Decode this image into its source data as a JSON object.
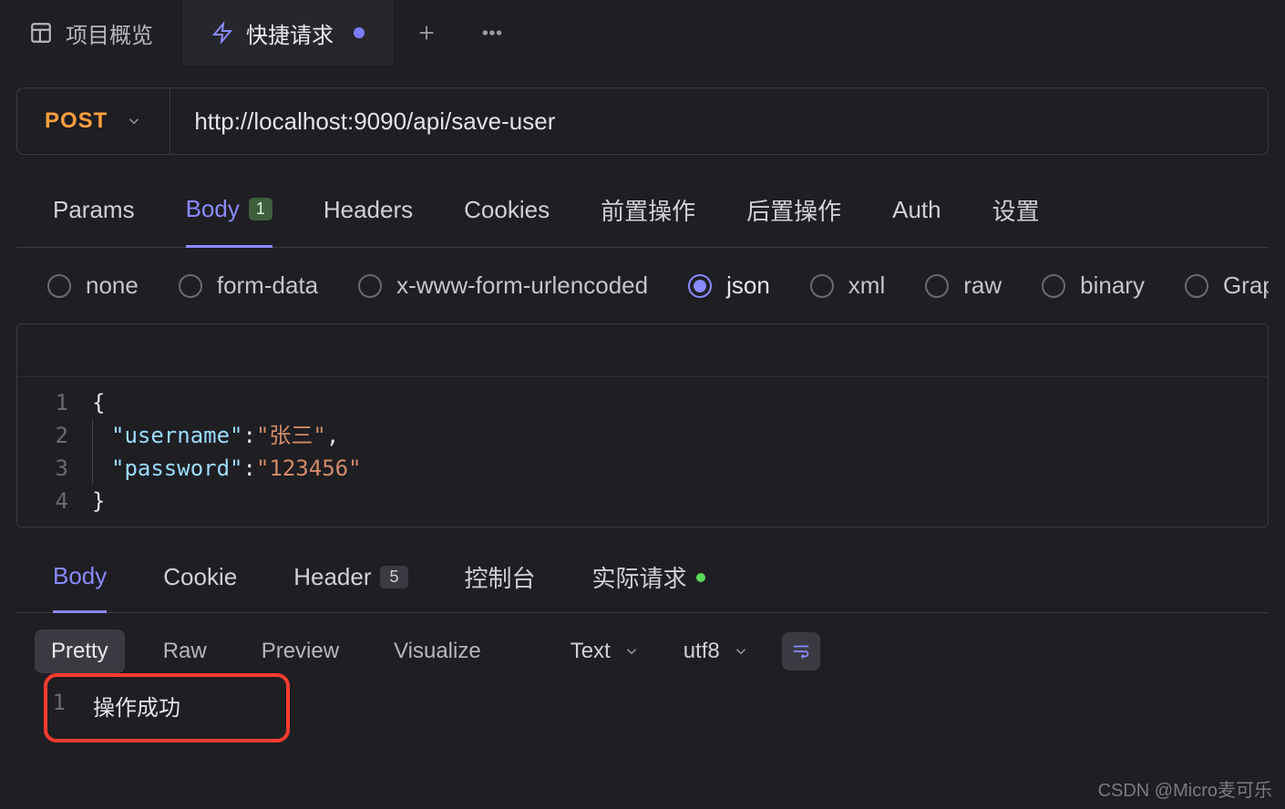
{
  "tabs": {
    "overview": "项目概览",
    "quick_request": "快捷请求"
  },
  "request": {
    "method": "POST",
    "url": "http://localhost:9090/api/save-user"
  },
  "req_tabs": {
    "params": "Params",
    "body": "Body",
    "body_badge": "1",
    "headers": "Headers",
    "cookies": "Cookies",
    "pre": "前置操作",
    "post": "后置操作",
    "auth": "Auth",
    "settings": "设置"
  },
  "body_types": {
    "none": "none",
    "form_data": "form-data",
    "x_www": "x-www-form-urlencoded",
    "json": "json",
    "xml": "xml",
    "raw": "raw",
    "binary": "binary",
    "graphql": "GraphQL"
  },
  "editor": {
    "l1": "{",
    "l2_k": "\"username\"",
    "l2_v": "\"张三\"",
    "l3_k": "\"password\"",
    "l3_v": "\"123456\"",
    "l4": "}",
    "n1": "1",
    "n2": "2",
    "n3": "3",
    "n4": "4"
  },
  "resp_tabs": {
    "body": "Body",
    "cookie": "Cookie",
    "header": "Header",
    "header_badge": "5",
    "console": "控制台",
    "actual_req": "实际请求"
  },
  "resp_controls": {
    "pretty": "Pretty",
    "raw": "Raw",
    "preview": "Preview",
    "visualize": "Visualize",
    "format": "Text",
    "encoding": "utf8"
  },
  "response": {
    "n1": "1",
    "l1": "操作成功"
  },
  "watermark": "CSDN @Micro麦可乐"
}
